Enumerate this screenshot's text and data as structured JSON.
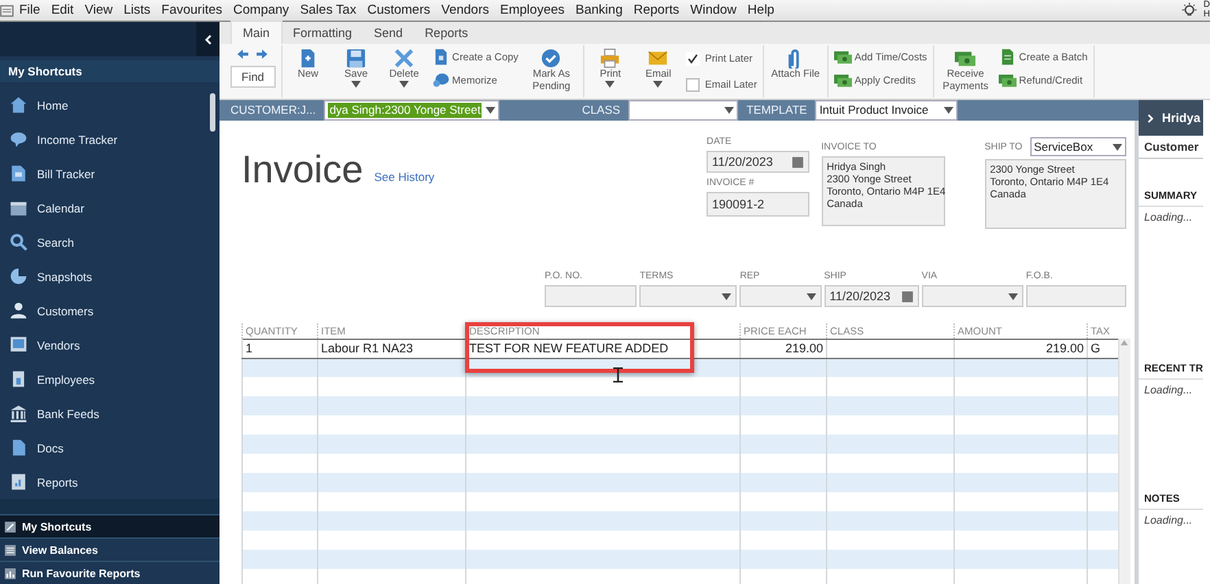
{
  "menu_bar": {
    "items": [
      "File",
      "Edit",
      "View",
      "Lists",
      "Favourites",
      "Company",
      "Sales Tax",
      "Customers",
      "Vendors",
      "Employees",
      "Banking",
      "Reports",
      "Window",
      "Help"
    ],
    "corner_text": [
      "D",
      "H"
    ]
  },
  "sidebar": {
    "header": "My Shortcuts",
    "items": [
      {
        "label": "Home"
      },
      {
        "label": "Income Tracker"
      },
      {
        "label": "Bill Tracker"
      },
      {
        "label": "Calendar"
      },
      {
        "label": "Search"
      },
      {
        "label": "Snapshots"
      },
      {
        "label": "Customers"
      },
      {
        "label": "Vendors"
      },
      {
        "label": "Employees"
      },
      {
        "label": "Bank Feeds"
      },
      {
        "label": "Docs"
      },
      {
        "label": "Reports"
      }
    ],
    "sections": [
      {
        "label": "My Shortcuts",
        "selected": true
      },
      {
        "label": "View Balances",
        "selected": false
      },
      {
        "label": "Run Favourite Reports",
        "selected": false
      }
    ]
  },
  "ribbon_tabs": [
    {
      "label": "Main",
      "selected": true
    },
    {
      "label": "Formatting",
      "selected": false
    },
    {
      "label": "Send",
      "selected": false
    },
    {
      "label": "Reports",
      "selected": false
    }
  ],
  "toolbar": [
    {
      "columns": [
        {
          "items": [
            {
              "kind": "find",
              "label": "Find"
            }
          ]
        }
      ]
    },
    {
      "columns": [
        {
          "items": [
            {
              "kind": "big",
              "label": "New",
              "dropdown": false
            }
          ]
        },
        {
          "items": [
            {
              "kind": "big",
              "label": "Save",
              "dropdown": true
            }
          ]
        },
        {
          "items": [
            {
              "kind": "big",
              "label": "Delete",
              "dropdown": true
            }
          ]
        },
        {
          "items": [
            {
              "kind": "small",
              "label": "Create a Copy"
            },
            {
              "kind": "small",
              "label": "Memorize"
            }
          ]
        },
        {
          "items": [
            {
              "kind": "big",
              "label": "Mark As Pending",
              "dropdown": false
            }
          ]
        }
      ]
    },
    {
      "columns": [
        {
          "items": [
            {
              "kind": "big",
              "label": "Print",
              "dropdown": true
            }
          ]
        },
        {
          "items": [
            {
              "kind": "big",
              "label": "Email",
              "dropdown": true
            }
          ]
        },
        {
          "items": [
            {
              "kind": "check",
              "label": "Print Later",
              "checked": true
            },
            {
              "kind": "check",
              "label": "Email Later",
              "checked": false
            }
          ]
        }
      ]
    },
    {
      "columns": [
        {
          "items": [
            {
              "kind": "big",
              "label": "Attach File",
              "dropdown": false
            }
          ]
        }
      ]
    },
    {
      "columns": [
        {
          "items": [
            {
              "kind": "small",
              "label": "Add Time/Costs"
            },
            {
              "kind": "small",
              "label": "Apply Credits"
            }
          ]
        }
      ]
    },
    {
      "columns": [
        {
          "items": [
            {
              "kind": "big",
              "label": "Receive Payments",
              "dropdown": false
            }
          ]
        },
        {
          "items": [
            {
              "kind": "small",
              "label": "Create a Batch"
            },
            {
              "kind": "small",
              "label": "Refund/Credit"
            }
          ]
        }
      ]
    }
  ],
  "customer_bar": {
    "customer_label": "CUSTOMER:J...",
    "customer_value": "dya  Singh:2300 Yonge Street",
    "customer_highlighted": true,
    "class_label": "CLASS",
    "template_label": "TEMPLATE",
    "template_value": "Intuit Product Invoice"
  },
  "invoice": {
    "title": "Invoice",
    "history_link": "See History",
    "date": {
      "label": "DATE",
      "value": "11/20/2023"
    },
    "number": {
      "label": "INVOICE #",
      "value": "190091-2"
    },
    "invoice_to": {
      "label": "INVOICE TO",
      "lines": [
        "Hridya  Singh",
        "2300 Yonge Street",
        "Toronto, Ontario M4P 1E4",
        "Canada"
      ]
    },
    "ship_to": {
      "label": "SHIP TO",
      "option": "ServiceBox",
      "lines": [
        "2300 Yonge Street",
        "Toronto, Ontario M4P 1E4",
        "Canada"
      ]
    },
    "fields": [
      {
        "label": "P.O. NO.",
        "kind": "text"
      },
      {
        "label": "TERMS",
        "kind": "dropdown"
      },
      {
        "label": "REP",
        "kind": "dropdown"
      },
      {
        "label": "SHIP",
        "kind": "date",
        "value": "11/20/2023"
      },
      {
        "label": "VIA",
        "kind": "dropdown"
      },
      {
        "label": "F.O.B.",
        "kind": "text"
      }
    ]
  },
  "table": {
    "columns": [
      "QUANTITY",
      "ITEM",
      "DESCRIPTION",
      "PRICE EACH",
      "CLASS",
      "AMOUNT",
      "TAX"
    ],
    "rows": [
      [
        "1",
        "Labour R1 NA23",
        "TEST FOR NEW FEATURE ADDED",
        "219.00",
        "",
        "219.00",
        "G"
      ]
    ]
  },
  "side_panel": {
    "title": "Hridya",
    "tab": "Customer",
    "sections": [
      {
        "heading": "SUMMARY",
        "status": "Loading..."
      },
      {
        "heading": "RECENT TR",
        "status": "Loading..."
      },
      {
        "heading": "NOTES",
        "status": "Loading..."
      }
    ]
  }
}
